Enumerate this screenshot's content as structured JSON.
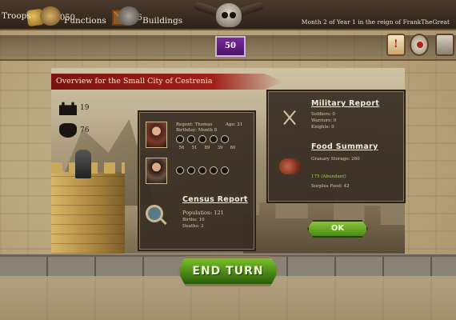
{
  "resources": {
    "gold": "10,050",
    "wood": "76"
  },
  "reign_text": "Month 2 of Year 1 in the reign of FrankTheGreat",
  "turn_number": "50",
  "nav": {
    "troops": "Troops",
    "functions": "Functions",
    "buildings": "Buildings"
  },
  "panel": {
    "title": "Overview for the Small City of Cestrenia",
    "stat_fort": "19",
    "stat_mask": "76"
  },
  "regent": {
    "line1": "Regent: Thomas",
    "age": "Age: 21",
    "birthday": "Birthday: Month 8",
    "values": [
      "56",
      "51",
      "89",
      "39",
      "80"
    ]
  },
  "census": {
    "title": "Census Report",
    "population": "Population: 121",
    "births": "Births: 10",
    "deaths": "Deaths: 2"
  },
  "military": {
    "title": "Military Report",
    "soldiers": "Soldiers: 0",
    "warriors": "Warriors: 0",
    "knights": "Knights: 0"
  },
  "food": {
    "title": "Food Summary",
    "granary": "Granary Storage: 260",
    "status": "175 (Abundant)",
    "surplus": "Surplus Food: 42"
  },
  "buttons": {
    "ok": "OK",
    "end_turn": "END TURN"
  },
  "colors": {
    "banner": "#a0201a",
    "accent_green": "#4a8a14",
    "turn_purple": "#5a1a7a"
  }
}
